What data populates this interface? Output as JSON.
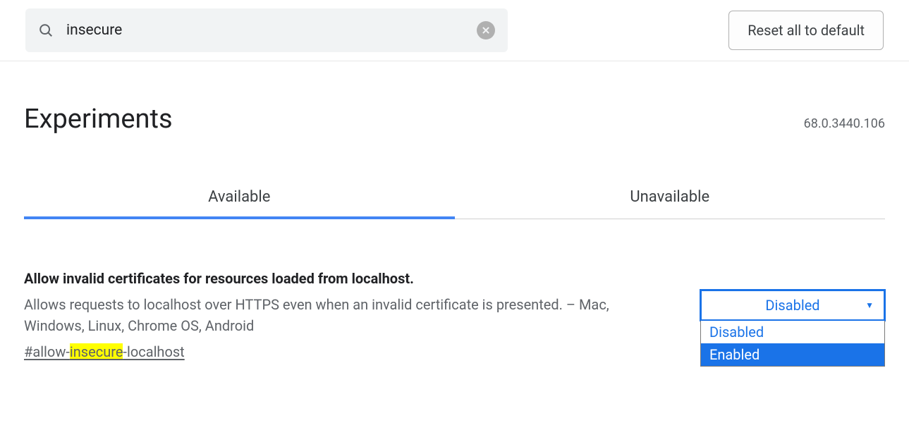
{
  "search": {
    "value": "insecure"
  },
  "reset_label": "Reset all to default",
  "page_title": "Experiments",
  "version": "68.0.3440.106",
  "tabs": {
    "available": "Available",
    "unavailable": "Unavailable"
  },
  "flag": {
    "title": "Allow invalid certificates for resources loaded from localhost.",
    "description": "Allows requests to localhost over HTTPS even when an invalid certificate is presented. – Mac, Windows, Linux, Chrome OS, Android",
    "hash_prefix": "#allow-",
    "hash_highlight": "insecure",
    "hash_suffix": "-localhost",
    "selected": "Disabled",
    "options": {
      "disabled": "Disabled",
      "enabled": "Enabled"
    }
  }
}
